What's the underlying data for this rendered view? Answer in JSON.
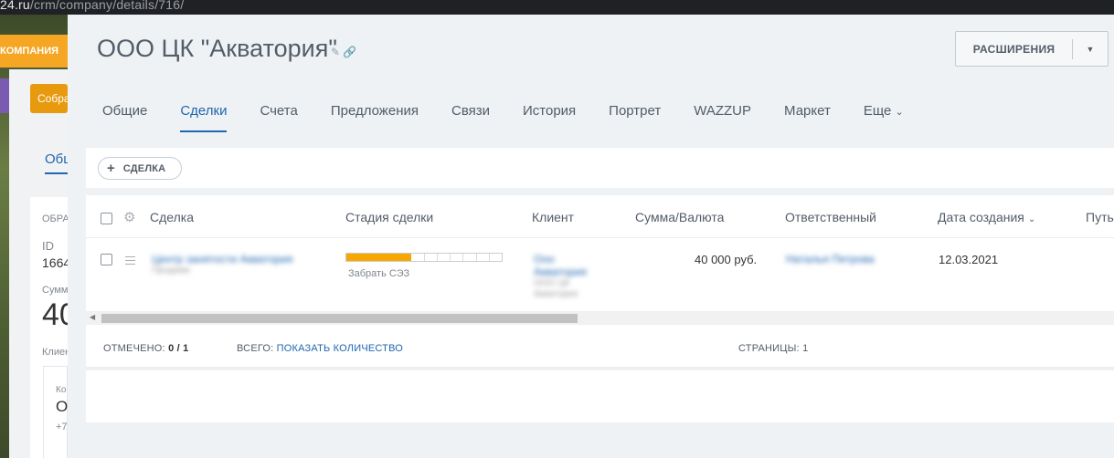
{
  "browser": {
    "url_host": "24.ru",
    "url_path": "/crm/company/details/716/"
  },
  "background": {
    "entity_tab": "КОМПАНИЯ",
    "button_label": "Собрать",
    "tab_label": "Общие",
    "section_label": "ОБРАЩ",
    "id_label": "ID",
    "id_value": "1664",
    "sum_label": "Сумма",
    "sum_value": "40",
    "client_label": "Клиент",
    "contact_label": "Ко",
    "contact_value": "О",
    "phone_value": "+7",
    "more_label": "Ко"
  },
  "header": {
    "title": "ООО ЦК \"Акватория\"",
    "edit_icon": "pencil-icon",
    "link_icon": "link-icon",
    "extensions_label": "РАСШИРЕНИЯ"
  },
  "tabs": [
    {
      "label": "Общие"
    },
    {
      "label": "Сделки",
      "active": true
    },
    {
      "label": "Счета"
    },
    {
      "label": "Предложения"
    },
    {
      "label": "Связи"
    },
    {
      "label": "История"
    },
    {
      "label": "Портрет"
    },
    {
      "label": "WAZZUP"
    },
    {
      "label": "Маркет"
    },
    {
      "label": "Еще"
    }
  ],
  "toolbar": {
    "add_deal_label": "СДЕЛКА"
  },
  "grid": {
    "columns": [
      "Сделка",
      "Стадия сделки",
      "Клиент",
      "Сумма/Валюта",
      "Ответственный",
      "Дата создания",
      "Путь"
    ],
    "rows": [
      {
        "deal_title": "Центр занятости Акватория",
        "deal_sub": "Продажи",
        "stage_name": "Забрать СЭЗ",
        "stage_filled": 5,
        "stage_total": 12,
        "client_line1": "Ооо",
        "client_line2": "Акватория",
        "client_line3": "ООО ЦК",
        "client_line4": "Акватория",
        "amount": "40 000 руб.",
        "responsible": "Наталья Петрова",
        "created": "12.03.2021"
      }
    ]
  },
  "footer": {
    "selected_label": "ОТМЕЧЕНО:",
    "selected_value": "0 / 1",
    "total_label": "ВСЕГО:",
    "total_link": "ПОКАЗАТЬ КОЛИЧЕСТВО",
    "pages_label": "СТРАНИЦЫ:",
    "pages_value": "1"
  }
}
